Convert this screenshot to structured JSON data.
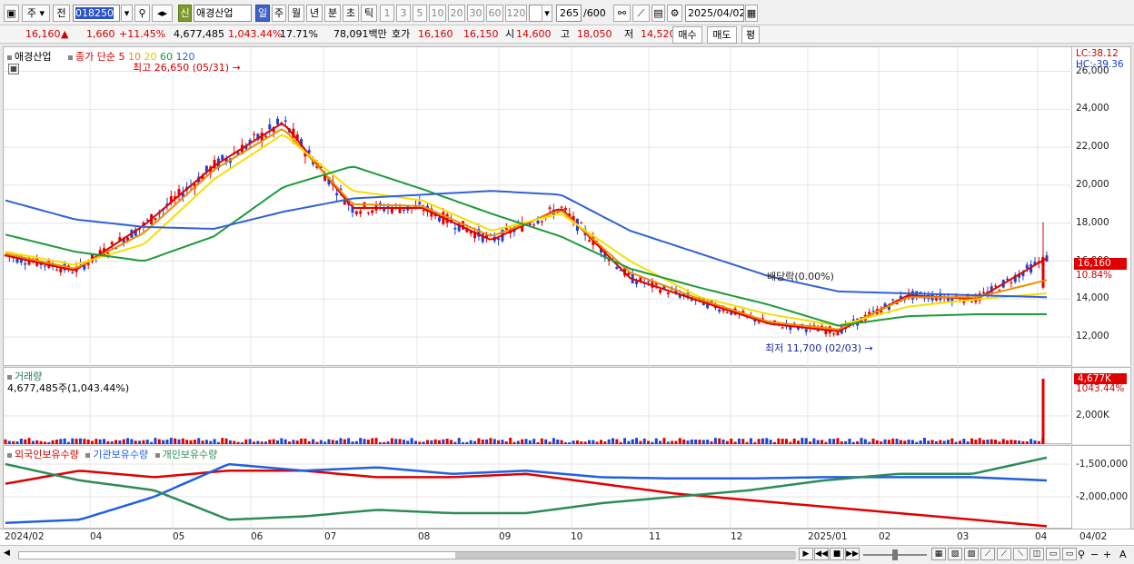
{
  "toolbar": {
    "market": "주",
    "cur": "전",
    "code": "018250",
    "name": "애경산업",
    "badge": "신",
    "periods": [
      "일",
      "주",
      "월",
      "년",
      "분",
      "초",
      "틱"
    ],
    "active_period": "일",
    "intervals": [
      "1",
      "3",
      "5",
      "10",
      "20",
      "30",
      "60",
      "120"
    ],
    "count": "265",
    "total": "/600",
    "date": "2025/04/02"
  },
  "quote": {
    "price": "16,160",
    "arrow": "▲",
    "change": "1,660",
    "pct": "+11.45%",
    "volume": "4,677,485",
    "vol_ratio": "1,043.44%",
    "turnover": "17.71%",
    "amount": "78,091백만",
    "bid_lbl": "호가",
    "bid": "16,160",
    "ask": "16,150",
    "open_lbl": "시",
    "open": "14,600",
    "high_lbl": "고",
    "high": "18,050",
    "low_lbl": "저",
    "low": "14,520",
    "buy": "매수",
    "sell": "매도",
    "avg": "평"
  },
  "price_pane": {
    "stock": "애경산업",
    "ma_title": "종가 단순",
    "ma_periods": [
      "5",
      "10",
      "20",
      "60",
      "120"
    ],
    "high_note": "최고 26,650 (05/31)",
    "low_note": "최저 11,700 (02/03)",
    "dividend": "배당락(0.00%)",
    "lc": "LC:38.12",
    "hc": "HC:-39.36",
    "last": "16,160",
    "last_pct": "10.84%"
  },
  "volume_pane": {
    "title": "거래량",
    "value": "4,677,485주(1,043.44%)",
    "last": "4,677K",
    "last_pct": "1043.44%",
    "tick": "2,000K"
  },
  "holdings_pane": {
    "foreign": "외국인보유수량",
    "inst": "기관보유수량",
    "indiv": "개인보유수량"
  },
  "x_labels": [
    "2024/02",
    "04",
    "05",
    "06",
    "07",
    "08",
    "09",
    "10",
    "11",
    "12",
    "2025/01",
    "02",
    "03",
    "04",
    "04/02"
  ],
  "colors": {
    "ma5": "#e00000",
    "ma10": "#f08c00",
    "ma20": "#f5e000",
    "ma60": "#1e9a3a",
    "ma120": "#3060d8",
    "up": "#e00000",
    "down": "#2040d0",
    "foreign": "#e00000",
    "inst": "#2060e0",
    "indiv": "#2e8b57"
  },
  "chart_data": [
    {
      "type": "line",
      "title": "애경산업",
      "subtitle": "종가 단순 5 10 20 60 120",
      "x": [
        "2024/02",
        "04",
        "05",
        "06",
        "07",
        "08",
        "09",
        "10",
        "11",
        "12",
        "2025/01",
        "02",
        "03",
        "04"
      ],
      "ylim": [
        11000,
        26600
      ],
      "yticks": [
        12000,
        14000,
        16000,
        18000,
        20000,
        22000,
        24000,
        26000
      ],
      "series": [
        {
          "name": "5",
          "values": [
            16300,
            15500,
            17900,
            21000,
            23300,
            18800,
            18800,
            17100,
            18800,
            15100,
            13900,
            12700,
            12300,
            14200,
            14000,
            16160
          ]
        },
        {
          "name": "10",
          "values": [
            16400,
            15600,
            17500,
            20800,
            23000,
            19000,
            18900,
            17300,
            18700,
            15400,
            14000,
            12800,
            12400,
            14100,
            14100,
            15000
          ]
        },
        {
          "name": "20",
          "values": [
            16500,
            15800,
            16900,
            20300,
            22700,
            19700,
            19200,
            17600,
            18500,
            16000,
            14100,
            13200,
            12600,
            13600,
            14000,
            14300
          ]
        },
        {
          "name": "60",
          "values": [
            17400,
            16500,
            16000,
            17300,
            19900,
            21000,
            19800,
            18500,
            17300,
            15600,
            14600,
            13700,
            12600,
            13100,
            13200,
            13200
          ]
        },
        {
          "name": "120",
          "values": [
            19200,
            18200,
            17800,
            17700,
            18600,
            19300,
            19500,
            19700,
            19500,
            17600,
            16400,
            15200,
            14400,
            14300,
            14200,
            14100
          ]
        }
      ]
    },
    {
      "type": "bar",
      "title": "거래량",
      "yticks": [
        2000000
      ],
      "last": 4677485
    },
    {
      "type": "line",
      "title": "보유수량",
      "yticks": [
        -1500000,
        -2000000
      ],
      "series": [
        {
          "name": "외국인보유수량",
          "values": [
            -1800000,
            -1600000,
            -1700000,
            -1600000,
            -1600000,
            -1700000,
            -1700000,
            -1650000,
            -1800000,
            -1950000,
            -2050000,
            -2150000,
            -2250000,
            -2350000,
            -2450000
          ]
        },
        {
          "name": "기관보유수량",
          "values": [
            -2400000,
            -2350000,
            -2000000,
            -1500000,
            -1600000,
            -1550000,
            -1650000,
            -1600000,
            -1700000,
            -1720000,
            -1720000,
            -1700000,
            -1700000,
            -1700000,
            -1750000
          ]
        },
        {
          "name": "개인보유수량",
          "values": [
            -1500000,
            -1750000,
            -1900000,
            -2350000,
            -2300000,
            -2200000,
            -2250000,
            -2250000,
            -2100000,
            -2000000,
            -1900000,
            -1750000,
            -1650000,
            -1650000,
            -1400000
          ]
        }
      ]
    }
  ]
}
